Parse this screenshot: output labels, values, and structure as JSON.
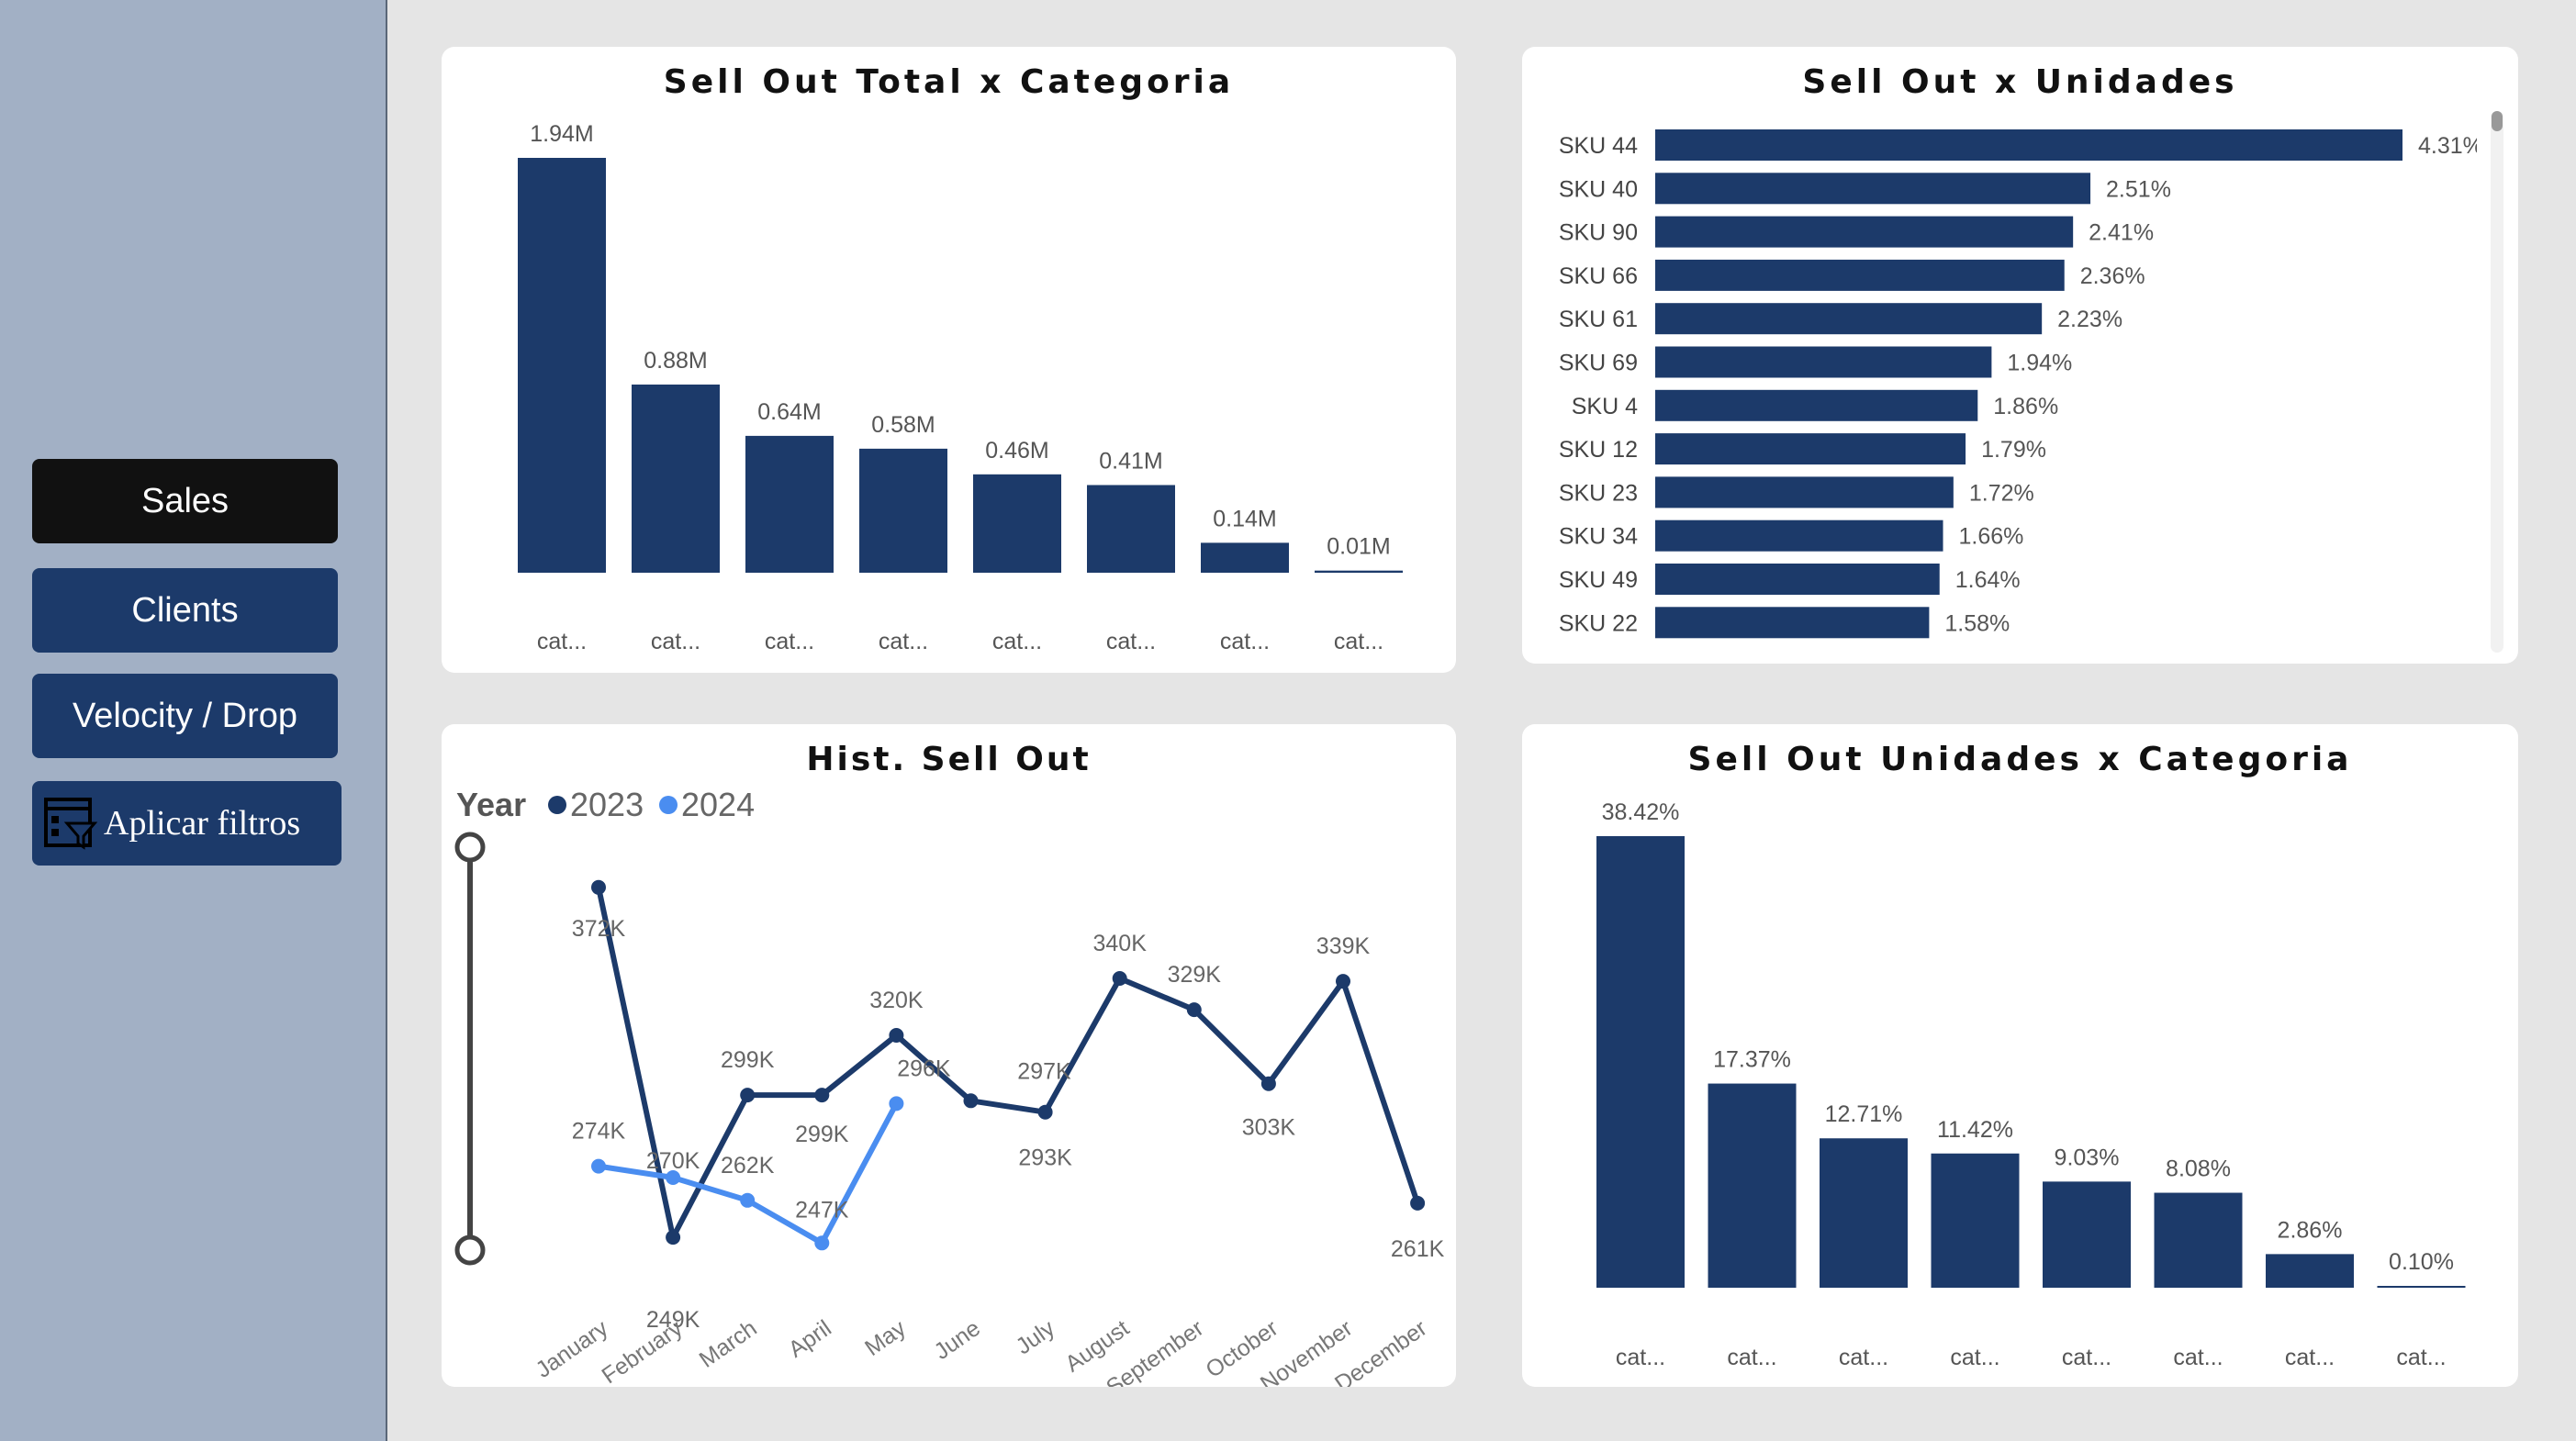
{
  "nav": {
    "sales": "Sales",
    "clients": "Clients",
    "velocity": "Velocity / Drop",
    "filters": "Aplicar filtros"
  },
  "colors": {
    "bar": "#1c3a6a",
    "series2023": "#1c3a6a",
    "series2024": "#4a8df0",
    "active_nav": "#111111",
    "nav": "#1c3a6a",
    "sidebar": "#a2b0c5"
  },
  "icons": {
    "filter_button": "filter-panel-icon"
  },
  "chart_data": [
    {
      "id": "sell_out_total_categoria",
      "type": "bar",
      "title": "Sell Out Total x Categoria",
      "categories": [
        "cat...",
        "cat...",
        "cat...",
        "cat...",
        "cat...",
        "cat...",
        "cat...",
        "cat..."
      ],
      "values": [
        1.94,
        0.88,
        0.64,
        0.58,
        0.46,
        0.41,
        0.14,
        0.01
      ],
      "data_labels": [
        "1.94M",
        "0.88M",
        "0.64M",
        "0.58M",
        "0.46M",
        "0.41M",
        "0.14M",
        "0.01M"
      ],
      "unit": "M",
      "ylim": [
        0,
        1.94
      ]
    },
    {
      "id": "sell_out_unidades",
      "type": "bar",
      "orientation": "horizontal",
      "title": "Sell Out x Unidades",
      "categories": [
        "SKU 44",
        "SKU 40",
        "SKU 90",
        "SKU 66",
        "SKU 61",
        "SKU 69",
        "SKU 4",
        "SKU 12",
        "SKU 23",
        "SKU 34",
        "SKU 49",
        "SKU 22"
      ],
      "values": [
        4.31,
        2.51,
        2.41,
        2.36,
        2.23,
        1.94,
        1.86,
        1.79,
        1.72,
        1.66,
        1.64,
        1.58
      ],
      "data_labels": [
        "4.31%",
        "2.51%",
        "2.41%",
        "2.36%",
        "2.23%",
        "1.94%",
        "1.86%",
        "1.79%",
        "1.72%",
        "1.66%",
        "1.64%",
        "1.58%"
      ],
      "unit": "%",
      "xlim": [
        0,
        4.31
      ]
    },
    {
      "id": "hist_sell_out",
      "type": "line",
      "title": "Hist. Sell Out",
      "legend_title": "Year",
      "legend_position": "top-left",
      "x": [
        "January",
        "February",
        "March",
        "April",
        "May",
        "June",
        "July",
        "August",
        "September",
        "October",
        "November",
        "December"
      ],
      "series": [
        {
          "name": "2023",
          "values": [
            372,
            249,
            299,
            299,
            320,
            297,
            293,
            340,
            329,
            303,
            339,
            261
          ],
          "data_labels": [
            "372K",
            "249K",
            "299K",
            "299K",
            "320K",
            "297K",
            "293K",
            "340K",
            "329K",
            "303K",
            "339K",
            "261K"
          ]
        },
        {
          "name": "2024",
          "values": [
            274,
            270,
            262,
            247,
            296
          ],
          "data_labels": [
            "274K",
            "270K",
            "262K",
            "247K",
            "296K"
          ]
        }
      ],
      "unit": "K",
      "ylim": [
        230,
        380
      ]
    },
    {
      "id": "sell_out_unidades_categoria",
      "type": "bar",
      "title": "Sell Out Unidades x Categoria",
      "categories": [
        "cat...",
        "cat...",
        "cat...",
        "cat...",
        "cat...",
        "cat...",
        "cat...",
        "cat..."
      ],
      "values": [
        38.42,
        17.37,
        12.71,
        11.42,
        9.03,
        8.08,
        2.86,
        0.1
      ],
      "data_labels": [
        "38.42%",
        "17.37%",
        "12.71%",
        "11.42%",
        "9.03%",
        "8.08%",
        "2.86%",
        "0.10%"
      ],
      "unit": "%",
      "ylim": [
        0,
        38.42
      ]
    }
  ]
}
